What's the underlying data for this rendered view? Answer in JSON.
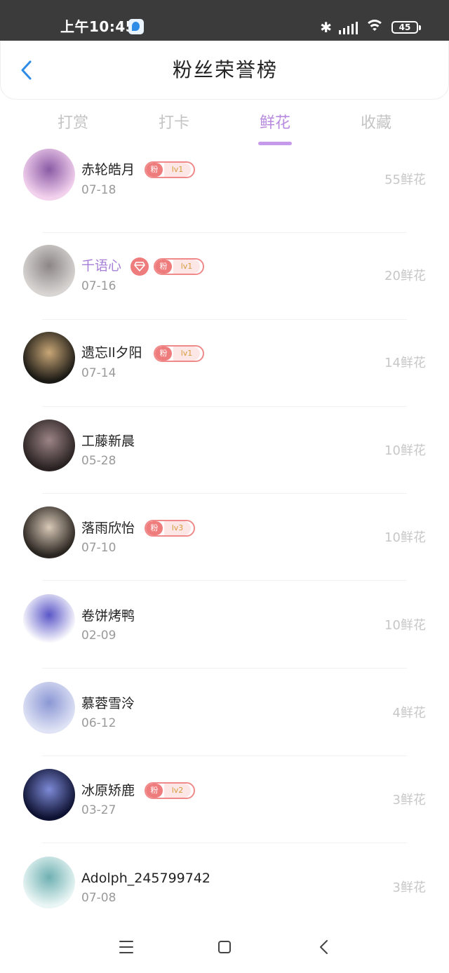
{
  "status_bar": {
    "time": "上午10:45",
    "battery": "45",
    "icons": [
      "bluetooth-icon",
      "signal-icon",
      "wifi-icon",
      "battery-icon"
    ]
  },
  "header": {
    "title": "粉丝荣誉榜",
    "back_icon": "chevron-left-icon"
  },
  "tabs": [
    {
      "label": "打赏",
      "active": false
    },
    {
      "label": "打卡",
      "active": false
    },
    {
      "label": "鲜花",
      "active": true
    },
    {
      "label": "收藏",
      "active": false
    }
  ],
  "fans": [
    {
      "name": "赤轮皓月",
      "date": "07-18",
      "count": "55鲜花",
      "badge": {
        "fan": "粉",
        "level": "lv1"
      },
      "avatar_colors": [
        "#f3d2ee",
        "#8a5aa5"
      ]
    },
    {
      "name": "千语心",
      "date": "07-16",
      "count": "20鲜花",
      "highlight": true,
      "diamond": true,
      "badge": {
        "fan": "粉",
        "level": "lv1"
      },
      "avatar_colors": [
        "#d8d4d2",
        "#8c8786"
      ]
    },
    {
      "name": "遗忘ll夕阳",
      "date": "07-14",
      "count": "14鲜花",
      "badge": {
        "fan": "粉",
        "level": "lv1"
      },
      "avatar_colors": [
        "#1c1a15",
        "#c9a777"
      ]
    },
    {
      "name": "工藤新晨",
      "date": "05-28",
      "count": "10鲜花",
      "avatar_colors": [
        "#2a2222",
        "#9c8486"
      ]
    },
    {
      "name": "落雨欣怡",
      "date": "07-10",
      "count": "10鲜花",
      "badge": {
        "fan": "粉",
        "level": "lv3"
      },
      "avatar_colors": [
        "#2a2520",
        "#d9c9b8"
      ]
    },
    {
      "name": "卷饼烤鸭",
      "date": "02-09",
      "count": "10鲜花",
      "avatar_colors": [
        "#ffffff",
        "#5b57c8"
      ]
    },
    {
      "name": "慕蓉雪泠",
      "date": "06-12",
      "count": "4鲜花",
      "avatar_colors": [
        "#dfe3f5",
        "#8b97d4"
      ]
    },
    {
      "name": "冰原矫鹿",
      "date": "03-27",
      "count": "3鲜花",
      "badge": {
        "fan": "粉",
        "level": "lv2"
      },
      "avatar_colors": [
        "#0e1232",
        "#7d8ad6"
      ]
    },
    {
      "name": "Adolph_245799742",
      "date": "07-08",
      "count": "3鲜花",
      "avatar_colors": [
        "#eaf6f5",
        "#6fb0b2"
      ]
    }
  ],
  "nav_bar": {
    "buttons": [
      "menu-icon",
      "home-icon",
      "back-icon"
    ]
  }
}
